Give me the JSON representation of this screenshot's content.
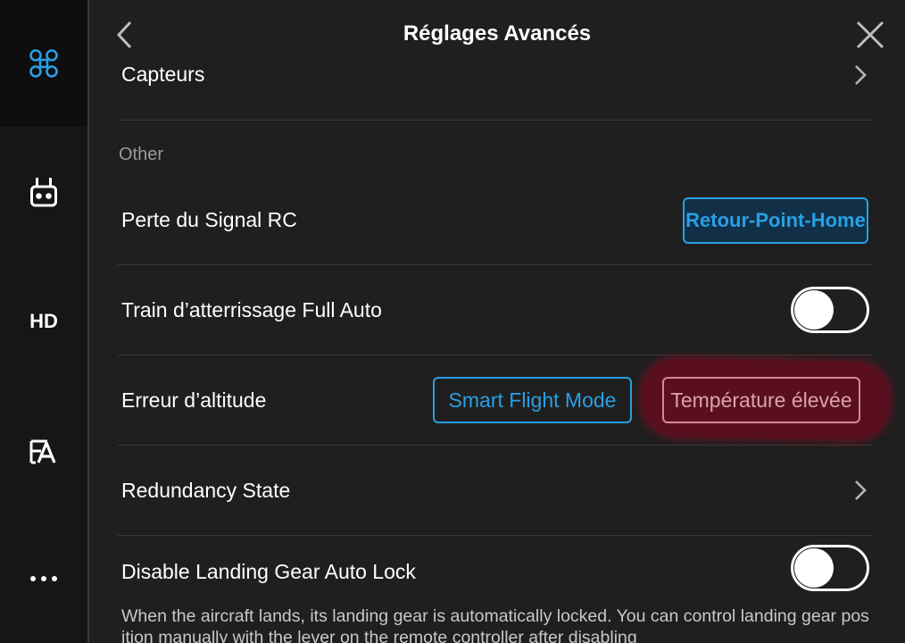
{
  "header": {
    "title": "Réglages Avancés"
  },
  "sidebar": {
    "items": [
      {
        "icon": "drone-icon",
        "active": true
      },
      {
        "icon": "remote-controller-icon"
      },
      {
        "label": "HD"
      },
      {
        "icon": "language-icon"
      },
      {
        "icon": "more-icon"
      }
    ]
  },
  "rows": {
    "capteurs": {
      "label": "Capteurs"
    },
    "section_other": "Other",
    "signal_loss": {
      "label": "Perte du Signal RC",
      "value": "Retour-Point-Home"
    },
    "landing_gear_auto": {
      "label": "Train d’atterrissage Full Auto",
      "toggle": false
    },
    "altitude_error": {
      "label": "Erreur d’altitude",
      "options": [
        "Smart Flight Mode",
        "Température élevée"
      ]
    },
    "redundancy": {
      "label": "Redundancy State"
    },
    "gear_lock": {
      "label": "Disable Landing Gear Auto Lock",
      "toggle": false
    }
  },
  "description": "When the aircraft lands, its landing gear is automatically locked. You can control landing gear position manually with the lever on the remote controller after disabling",
  "colors": {
    "accent": "#2a9fe4",
    "highlight": "#5a0f1f",
    "background": "#1f1f1f"
  }
}
